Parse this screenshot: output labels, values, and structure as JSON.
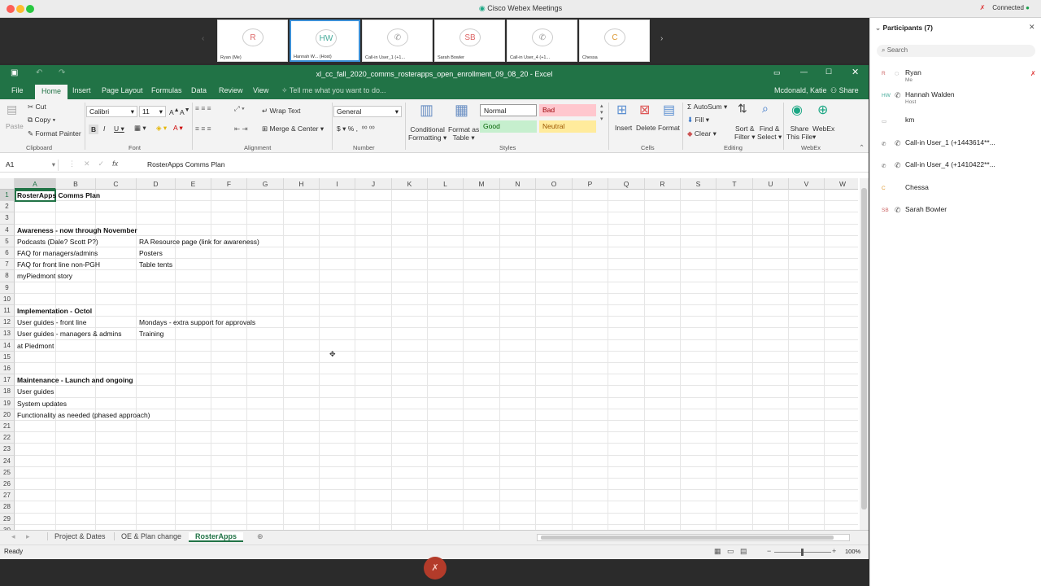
{
  "mac": {
    "title": "Cisco Webex Meetings",
    "status": "Connected"
  },
  "strip": {
    "tiles": [
      {
        "initials": "R",
        "label": "Ryan (Me)"
      },
      {
        "initials": "HW",
        "label": "Hannah W... (Host)"
      },
      {
        "initials": "",
        "label": "Call-in User_1 (+1..."
      },
      {
        "initials": "SB",
        "label": "Sarah Bowler"
      },
      {
        "initials": "",
        "label": "Call-in User_4 (+1..."
      },
      {
        "initials": "C",
        "label": "Chessa"
      }
    ]
  },
  "excel": {
    "title": "xl_cc_fall_2020_comms_rosterapps_open_enrollment_09_08_20 - Excel",
    "user": "Mcdonald, Katie",
    "share": "Share",
    "tabs": [
      "File",
      "Home",
      "Insert",
      "Page Layout",
      "Formulas",
      "Data",
      "Review",
      "View"
    ],
    "tellme": "Tell me what you want to do...",
    "ribbon": {
      "paste": "Paste",
      "cut": "Cut",
      "copy": "Copy",
      "format_painter": "Format Painter",
      "clipboard": "Clipboard",
      "font_name": "Calibri",
      "font_size": "11",
      "font": "Font",
      "wrap_text": "Wrap Text",
      "merge_center": "Merge & Center",
      "alignment": "Alignment",
      "number_format": "General",
      "number": "Number",
      "conditional": "Conditional",
      "formatting": "Formatting",
      "format_as": "Format as",
      "table": "Table",
      "style_normal": "Normal",
      "style_bad": "Bad",
      "style_good": "Good",
      "style_neutral": "Neutral",
      "styles": "Styles",
      "insert": "Insert",
      "delete": "Delete",
      "format": "Format",
      "cells": "Cells",
      "autosum": "AutoSum",
      "fill": "Fill",
      "clear": "Clear",
      "sort1": "Sort &",
      "sort2": "Filter",
      "find1": "Find &",
      "find2": "Select",
      "editing": "Editing",
      "share1": "Share",
      "share2": "This File",
      "webex": "WebEx",
      "webex_group": "WebEx"
    },
    "namebox": "A1",
    "formula": "RosterApps Comms Plan",
    "columns": [
      "A",
      "B",
      "C",
      "D",
      "E",
      "F",
      "G",
      "H",
      "I",
      "J",
      "K",
      "L",
      "M",
      "N",
      "O",
      "P",
      "Q",
      "R",
      "S",
      "T",
      "U",
      "V",
      "W"
    ],
    "rows": [
      "1",
      "2",
      "3",
      "4",
      "5",
      "6",
      "7",
      "8",
      "9",
      "10",
      "11",
      "12",
      "13",
      "14",
      "15",
      "16",
      "17",
      "18",
      "19",
      "20",
      "21",
      "22",
      "23",
      "24",
      "25",
      "26",
      "27",
      "28",
      "29",
      "30"
    ],
    "cells": {
      "a1": "RosterApps Comms Plan",
      "a4": "Awareness - now through November",
      "a5": "Podcasts (Dale? Scott P?)",
      "d5": "RA Resource page (link for awareness)",
      "a6": "FAQ for managers/admins",
      "d6": "Posters",
      "a7": "FAQ for front line non-PGH",
      "d7": "Table tents",
      "a8": "myPiedmont story",
      "a11": "Implementation - Octol",
      "a12": "User guides - front line",
      "d12": "Mondays - extra support for approvals",
      "a13": "User guides - managers & admins",
      "d13": "Training",
      "a14": "at Piedmont",
      "a17": "Maintenance - Launch and ongoing",
      "a18": "User guides",
      "a19": "System updates",
      "a20": "Functionality as needed (phased approach)"
    },
    "sheets": [
      "Project & Dates",
      "OE & Plan change",
      "RosterApps"
    ],
    "status": "Ready",
    "zoom": "100%"
  },
  "panel": {
    "title": "Participants (7)",
    "search": "Search",
    "people": [
      {
        "initials": "R",
        "name": "Ryan",
        "sub": "Me"
      },
      {
        "initials": "HW",
        "name": "Hannah Walden",
        "sub": "Host"
      },
      {
        "initials": "",
        "name": "km",
        "sub": ""
      },
      {
        "initials": "",
        "name": "Call-in User_1 (+1443614**...",
        "sub": ""
      },
      {
        "initials": "",
        "name": "Call-in User_4 (+1410422**...",
        "sub": ""
      },
      {
        "initials": "C",
        "name": "Chessa",
        "sub": ""
      },
      {
        "initials": "SB",
        "name": "Sarah Bowler",
        "sub": ""
      }
    ]
  }
}
